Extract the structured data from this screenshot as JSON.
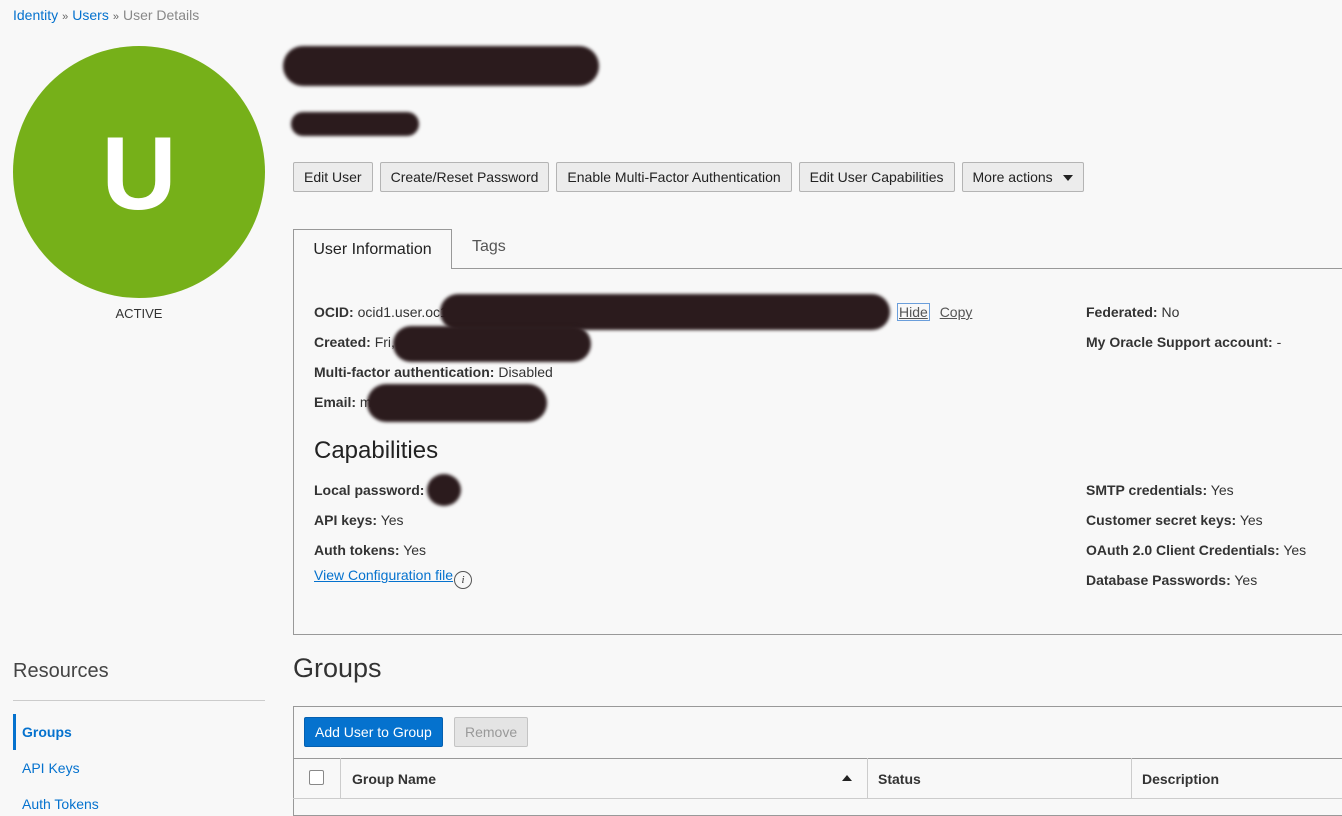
{
  "breadcrumb": {
    "identity": "Identity",
    "users": "Users",
    "current": "User Details",
    "separator": "»"
  },
  "avatar": {
    "letter": "U",
    "status": "ACTIVE",
    "color": "#76b019"
  },
  "actions": {
    "edit_user": "Edit User",
    "reset_password": "Create/Reset Password",
    "enable_mfa": "Enable Multi-Factor Authentication",
    "edit_capabilities": "Edit User Capabilities",
    "more_actions": "More actions"
  },
  "tabs": {
    "user_information": "User Information",
    "tags": "Tags"
  },
  "user_info": {
    "ocid_label": "OCID:",
    "ocid_value": "ocid1.user.oc1",
    "hide": "Hide",
    "copy": "Copy",
    "created_label": "Created:",
    "created_value": "Fri,",
    "mfa_label": "Multi-factor authentication:",
    "mfa_value": "Disabled",
    "email_label": "Email:",
    "email_value": "m",
    "federated_label": "Federated:",
    "federated_value": "No",
    "mos_label": "My Oracle Support account:",
    "mos_value": "-"
  },
  "capabilities": {
    "title": "Capabilities",
    "local_password_label": "Local password:",
    "api_keys_label": "API keys:",
    "api_keys_value": "Yes",
    "auth_tokens_label": "Auth tokens:",
    "auth_tokens_value": "Yes",
    "view_config": "View Configuration file",
    "smtp_label": "SMTP credentials:",
    "smtp_value": "Yes",
    "customer_secret_label": "Customer secret keys:",
    "customer_secret_value": "Yes",
    "oauth_label": "OAuth 2.0 Client Credentials:",
    "oauth_value": "Yes",
    "db_passwords_label": "Database Passwords:",
    "db_passwords_value": "Yes"
  },
  "resources": {
    "title": "Resources",
    "items": [
      "Groups",
      "API Keys",
      "Auth Tokens"
    ]
  },
  "groups": {
    "title": "Groups",
    "add_button": "Add User to Group",
    "remove_button": "Remove",
    "columns": [
      "Group Name",
      "Status",
      "Description"
    ]
  },
  "colors": {
    "accent": "#0572ce",
    "avatar": "#76b019"
  }
}
